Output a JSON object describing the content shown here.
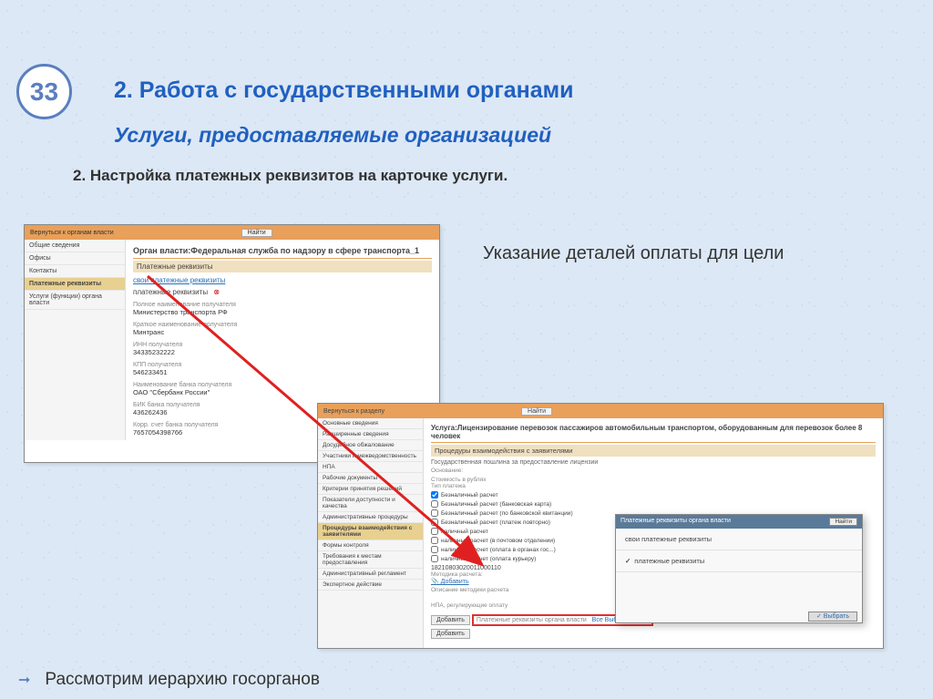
{
  "slideNumber": "33",
  "heading1": "2. Работа с государственными органами",
  "heading2": "Услуги, предоставляемые организацией",
  "heading3": "2. Настройка платежных реквизитов на карточке услуги.",
  "annotation": "Указание деталей оплаты для цели",
  "bullet": "Рассмотрим иерархию госорганов",
  "shot1": {
    "back": "Вернуться к органам власти",
    "searchBtn": "Найти",
    "sidebar": [
      "Общие сведения",
      "Офисы",
      "Контакты",
      "Платежные реквизиты",
      "Услуги (функции) органа власти"
    ],
    "title": "Орган власти:Федеральная служба по надзору в сфере транспорта_1",
    "subtitle": "Платежные реквизиты",
    "link": "свои платежные реквизиты",
    "chip": "платежные реквизиты",
    "fields": [
      {
        "lbl": "Полное наименование получателя",
        "val": "Министерство транспорта РФ"
      },
      {
        "lbl": "Краткое наименование получателя",
        "val": "Минтранс"
      },
      {
        "lbl": "ИНН получателя",
        "val": "34335232222"
      },
      {
        "lbl": "КПП получателя",
        "val": "546233451"
      },
      {
        "lbl": "Наименование банка получателя",
        "val": "ОАО \"Сбербанк России\""
      },
      {
        "lbl": "БИК банка получателя",
        "val": "436262436"
      },
      {
        "lbl": "Корр. счет банка получателя",
        "val": "7657054398766"
      }
    ]
  },
  "shot2": {
    "back": "Вернуться к разделу",
    "searchBtn": "Найти",
    "sidebar": [
      "Основные сведения",
      "Расширенные сведения",
      "Досудебное обжалование",
      "Участники и межведомственность",
      "НПА",
      "Рабочие документы",
      "Критерии принятия решений",
      "Показатели доступности и качества",
      "Административные процедуры",
      "Процедуры взаимодействия с заявителями",
      "Формы контроля",
      "Требования к местам предоставления",
      "Административный регламент",
      "Экспертное действие"
    ],
    "title": "Услуга:Лицензирование перевозок пассажиров автомобильным транспортом, оборудованным для перевозок более 8 человек",
    "subtitle": "Процедуры взаимодействия с заявителями",
    "row1": "Государственная пошлина за предоставление лицензии",
    "row2": "Основание:",
    "lbls": {
      "cost": "Стоимость в рублях",
      "type": "Тип платежа"
    },
    "checks": [
      "Безналичный расчет",
      "Безналичный расчет (банковская карта)",
      "Безналичный расчет (по банковской квитанции)",
      "Безналичный расчет (платеж повторно)",
      "наличный расчет",
      "наличный расчет (в почтовом отделении)",
      "наличный расчет (оплата в органах гос...)",
      "наличный расчет (оплата курьеру)"
    ],
    "kbk": "18210803020011000110",
    "kbklbl": "Методика расчета:",
    "addFile": "Добавить",
    "descLbl": "Описание методики расчета",
    "npaLbl": "НПА, регулирующие оплату",
    "addBtn": "Добавить",
    "hlLabel": "Платежные реквизиты органа власти",
    "hlVal": "Все Выбранные (1)",
    "addBtn2": "Добавить"
  },
  "dialog": {
    "title": "Платежные реквизиты органа власти",
    "searchBtn": "Найти",
    "rows": [
      "свои платежные реквизиты",
      "платежные реквизиты"
    ],
    "ok": "Выбрать"
  }
}
